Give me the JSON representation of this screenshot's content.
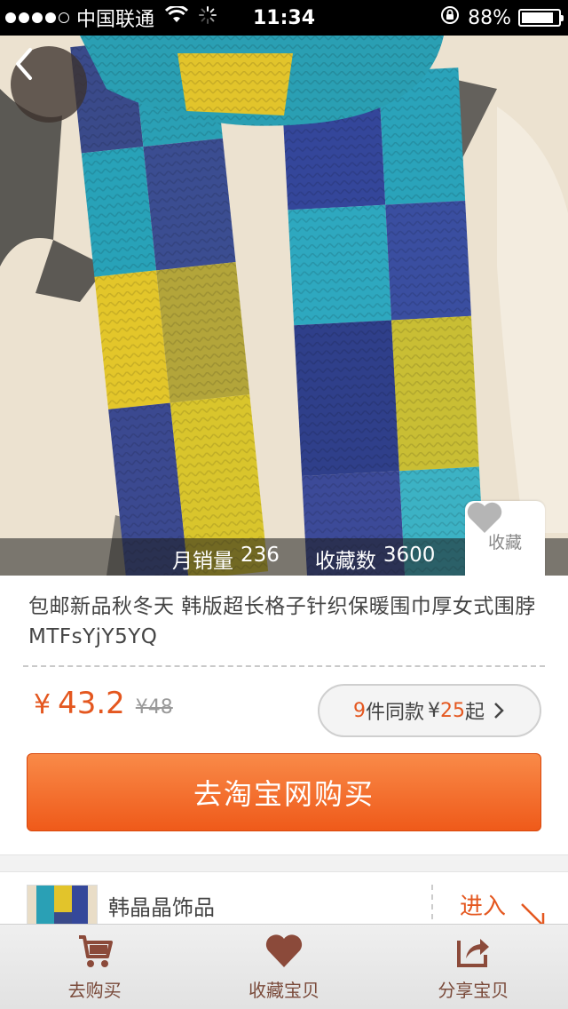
{
  "status_bar": {
    "carrier": "中国联通",
    "time": "11:34",
    "battery": "88%",
    "battery_level": 0.88
  },
  "hero": {
    "monthly_sales_label": "月销量",
    "monthly_sales": "236",
    "favorites_label": "收藏数",
    "favorites": "3600",
    "favorite_button": "收藏"
  },
  "product": {
    "title": "包邮新品秋冬天 韩版超长格子针织保暖围巾厚女式围脖MTFsYjY5YQ",
    "price_symbol": "¥",
    "price": "43.2",
    "original_price": "¥48",
    "same_count": "9",
    "same_text": "件同款",
    "same_price": "¥",
    "same_from_price": "25",
    "same_suffix": "起",
    "buy_button": "去淘宝网购买"
  },
  "shop": {
    "name": "韩晶晶饰品",
    "enter": "进入"
  },
  "tab_bar": {
    "tabs": [
      {
        "label": "去购买",
        "icon": "cart-icon"
      },
      {
        "label": "收藏宝贝",
        "icon": "heart-icon"
      },
      {
        "label": "分享宝贝",
        "icon": "share-icon"
      }
    ]
  },
  "colors": {
    "accent": "#e4571f",
    "tab_icon": "#8b4a3a"
  }
}
